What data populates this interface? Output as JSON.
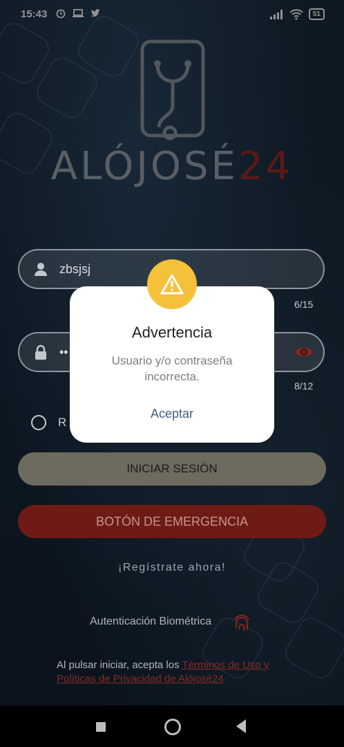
{
  "status_bar": {
    "time": "15:43",
    "battery": "51"
  },
  "logo": {
    "text_main": "ALÓJOSÉ",
    "text_accent": "24"
  },
  "login": {
    "username_value": "zbsjsj",
    "username_counter": "6/15",
    "password_value": "••",
    "password_counter": "8/12",
    "remember_label": "R",
    "login_button": "INICIAR SESIÓN",
    "emergency_button": "BOTÓN DE EMERGENCIA",
    "register_link": "¡Regístrate ahora!",
    "biometric_label": "Autenticación Biométrica",
    "terms_prefix": "Al pulsar iniciar, acepta los ",
    "terms_link": "Términos de Uso y Políticas de Privacidad de Alójosé24"
  },
  "dialog": {
    "title": "Advertencia",
    "message": "Usuario y/o contraseña incorrecta.",
    "button": "Aceptar"
  },
  "colors": {
    "warning": "#f5c13a",
    "accent_red": "#9e2b25",
    "dialog_button": "#3f5f7e"
  }
}
